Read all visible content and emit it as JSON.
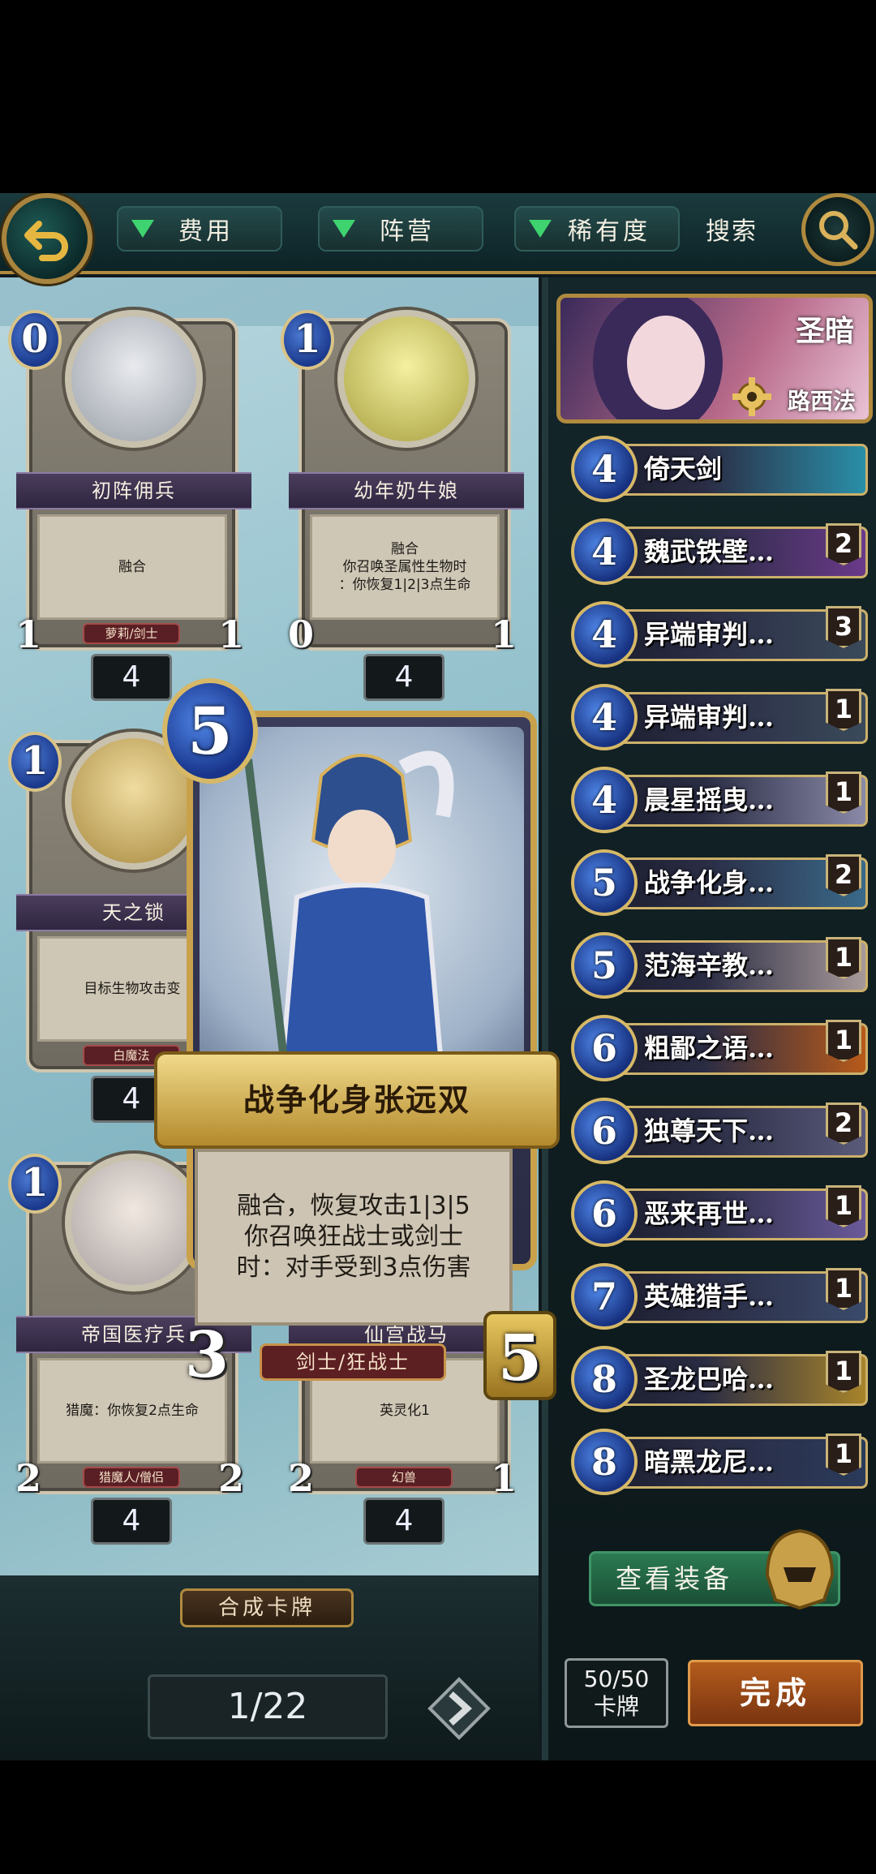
{
  "top": {
    "filters": [
      "费用",
      "阵营",
      "稀有度"
    ],
    "search_label": "搜索"
  },
  "grid": [
    {
      "cost": "0",
      "name": "初阵佣兵",
      "text": "融合",
      "race": "萝莉/剑士",
      "atk": "1",
      "hp": "1",
      "count": "4"
    },
    {
      "cost": "1",
      "name": "幼年奶牛娘",
      "text": "融合\n你召唤圣属性生物时\n：你恢复1|2|3点生命",
      "race": "",
      "atk": "0",
      "hp": "1",
      "count": "4"
    },
    {
      "cost": "1",
      "name": "天之锁",
      "text": "目标生物攻击变",
      "race": "白魔法",
      "atk": "",
      "hp": "",
      "count": "4"
    },
    {
      "cost": "1",
      "name": "帝国医疗兵",
      "text": "猎魔：你恢复2点生命",
      "race": "猎魔人/僧侣",
      "atk": "2",
      "hp": "2",
      "count": "4"
    },
    {
      "cost": "",
      "name": "仙宫战马",
      "text": "英灵化1",
      "race": "幻兽",
      "atk": "2",
      "hp": "1",
      "count": "4"
    }
  ],
  "highlight": {
    "cost": "5",
    "name": "战争化身张远双",
    "text": "融合，恢复攻击1|3|5\n你召唤狂战士或剑士\n时：对手受到3点伤害",
    "race": "剑士/狂战士",
    "atk": "3",
    "hp": "5"
  },
  "leader": {
    "faction": "圣暗",
    "name": "路西法"
  },
  "deck": [
    {
      "cost": "4",
      "name": "倚天剑",
      "qty": "",
      "bg": "#2a8fa8"
    },
    {
      "cost": "4",
      "name": "魏武铁壁…",
      "qty": "2",
      "bg": "#6a3a8a"
    },
    {
      "cost": "4",
      "name": "异端审判…",
      "qty": "3",
      "bg": "#3a4a5a"
    },
    {
      "cost": "4",
      "name": "异端审判…",
      "qty": "1",
      "bg": "#3a4a5a"
    },
    {
      "cost": "4",
      "name": "晨星摇曳…",
      "qty": "1",
      "bg": "#8a8aa8"
    },
    {
      "cost": "5",
      "name": "战争化身…",
      "qty": "2",
      "bg": "#3a6a8a"
    },
    {
      "cost": "5",
      "name": "范海辛教…",
      "qty": "1",
      "bg": "#a89a9a"
    },
    {
      "cost": "6",
      "name": "粗鄙之语…",
      "qty": "1",
      "bg": "#b85a1a"
    },
    {
      "cost": "6",
      "name": "独尊天下…",
      "qty": "2",
      "bg": "#5a5a7a"
    },
    {
      "cost": "6",
      "name": "恶来再世…",
      "qty": "1",
      "bg": "#6a5a9a"
    },
    {
      "cost": "7",
      "name": "英雄猎手…",
      "qty": "1",
      "bg": "#3a4a6a"
    },
    {
      "cost": "8",
      "name": "圣龙巴哈…",
      "qty": "1",
      "bg": "#a8842a"
    },
    {
      "cost": "8",
      "name": "暗黑龙尼…",
      "qty": "1",
      "bg": "#2a3a5a"
    }
  ],
  "equip_label": "查看装备",
  "craft_label": "合成卡牌",
  "page": "1/22",
  "deck_count": {
    "count": "50/50",
    "unit": "卡牌"
  },
  "done_label": "完成"
}
